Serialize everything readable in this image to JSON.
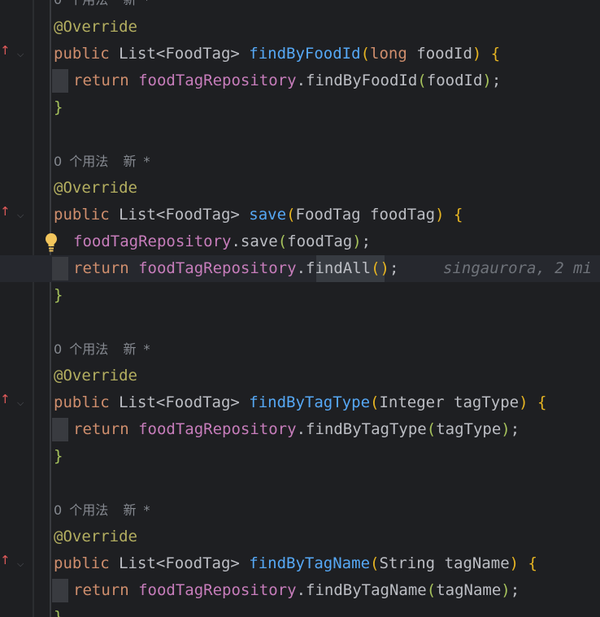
{
  "editor": {
    "hint_usages": "0 个用法",
    "hint_new": "新 *",
    "annotation": "@Override",
    "kw_public": "public",
    "kw_return": "return",
    "type_list": "List",
    "type_foodtag": "FoodTag",
    "repo": "foodTagRepository",
    "methods": [
      {
        "name": "findByFoodId",
        "param_type": "long",
        "param_name": "foodId",
        "call": "findByFoodId",
        "arg": "foodId"
      },
      {
        "name": "save",
        "param_type": "FoodTag",
        "param_name": "foodTag",
        "call_save": "save",
        "arg_save": "foodTag",
        "call": "findAll",
        "inline_hint": "singaurora, 2 mi"
      },
      {
        "name": "findByTagType",
        "param_type": "Integer",
        "param_name": "tagType",
        "call": "findByTagType",
        "arg": "tagType"
      },
      {
        "name": "findByTagName",
        "param_type": "String",
        "param_name": "tagName",
        "call": "findByTagName",
        "arg": "tagName"
      }
    ]
  },
  "colors": {
    "background": "#1e1f22",
    "keyword": "#cf8e6d",
    "annotation": "#b3ae60",
    "method": "#56a8f5",
    "field": "#c77dbb",
    "implements_marker": "#e05a5a"
  },
  "icons": [
    "implements-up-arrow-icon",
    "fold-chevron-icon",
    "lightbulb-icon"
  ]
}
